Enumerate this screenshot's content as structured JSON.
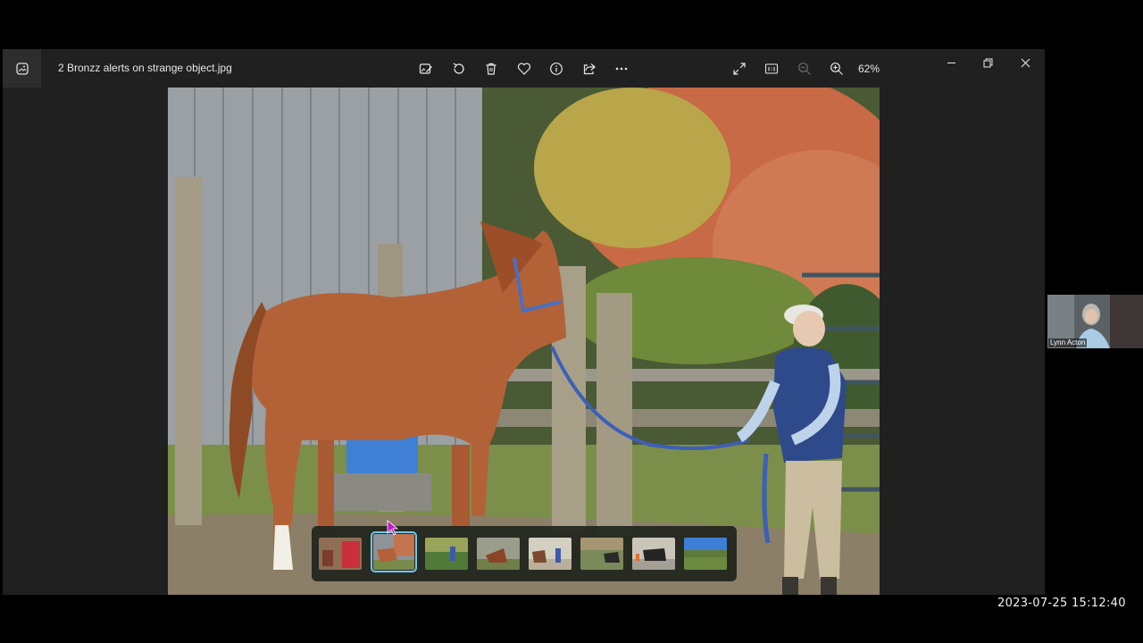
{
  "app": {
    "file_title": "2 Bronzz alerts on strange object.jpg",
    "zoom": "62%"
  },
  "toolbar": {
    "icons": [
      "edit-image-icon",
      "rotate-icon",
      "delete-icon",
      "favorite-icon",
      "info-icon",
      "share-icon",
      "more-icon"
    ],
    "view_icons": [
      "fullscreen-icon",
      "actual-size-icon",
      "zoom-out-icon",
      "zoom-in-icon"
    ]
  },
  "window_controls": [
    "minimize-icon",
    "restore-icon",
    "close-icon"
  ],
  "filmstrip": {
    "count": 8,
    "selected_index": 1
  },
  "participant": {
    "name": "Lynn Acton"
  },
  "recording": {
    "timestamp": "2023-07-25  15:12:40"
  },
  "colors": {
    "window_bg": "#202020",
    "accent": "#6fc6f0",
    "cursor": "#c21ac9"
  }
}
